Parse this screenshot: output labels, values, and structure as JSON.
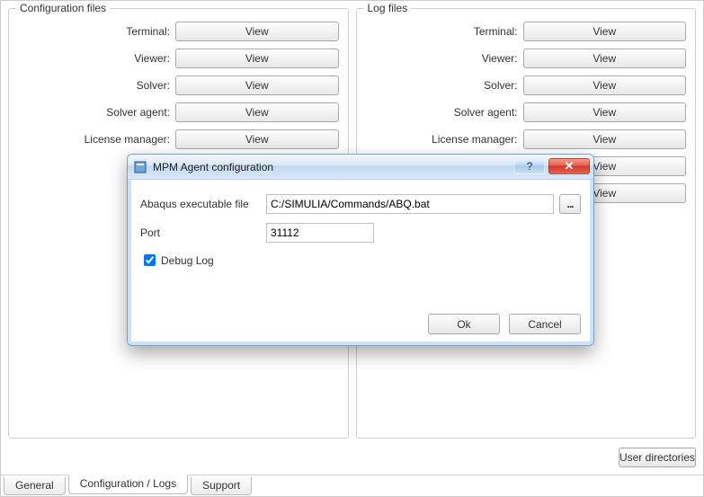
{
  "config_panel": {
    "title": "Configuration files",
    "rows": [
      {
        "label": "Terminal:",
        "button": "View"
      },
      {
        "label": "Viewer:",
        "button": "View"
      },
      {
        "label": "Solver:",
        "button": "View"
      },
      {
        "label": "Solver agent:",
        "button": "View"
      },
      {
        "label": "License manager:",
        "button": "View"
      }
    ]
  },
  "log_panel": {
    "title": "Log files",
    "rows": [
      {
        "label": "Terminal:",
        "button": "View"
      },
      {
        "label": "Viewer:",
        "button": "View"
      },
      {
        "label": "Solver:",
        "button": "View"
      },
      {
        "label": "Solver agent:",
        "button": "View"
      },
      {
        "label": "License manager:",
        "button": "View"
      },
      {
        "label": "",
        "button": "View"
      },
      {
        "label": "",
        "button": "View"
      }
    ]
  },
  "footer": {
    "user_directories": "User directories"
  },
  "tabs": {
    "general": "General",
    "config_logs": "Configuration / Logs",
    "support": "Support"
  },
  "dialog": {
    "title": "MPM Agent configuration",
    "abq_label": "Abaqus executable file",
    "abq_value": "C:/SIMULIA/Commands/ABQ.bat",
    "browse_label": "...",
    "port_label": "Port",
    "port_value": "31112",
    "debug_label": "Debug Log",
    "debug_checked": true,
    "ok": "Ok",
    "cancel": "Cancel",
    "help": "?",
    "close": "✕"
  }
}
